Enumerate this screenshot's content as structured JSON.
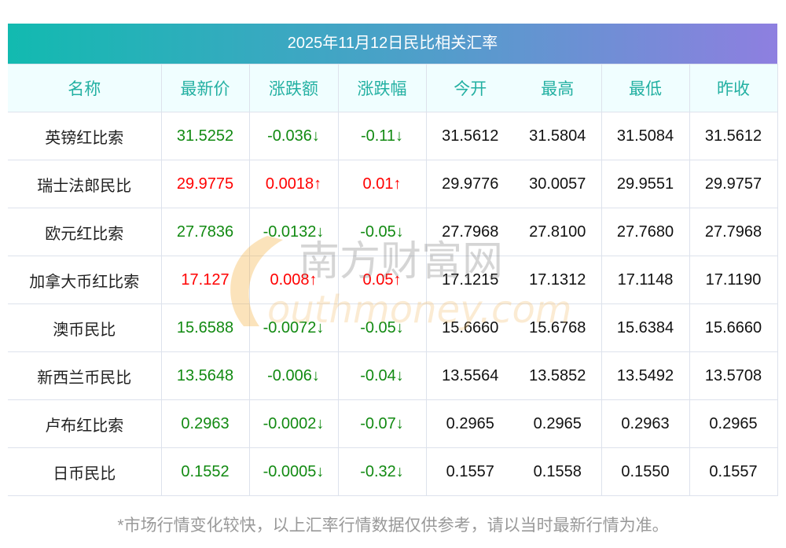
{
  "title": "2025年11月12日民比相关汇率",
  "headers": [
    "名称",
    "最新价",
    "涨跌额",
    "涨跌幅",
    "今开",
    "最高",
    "最低",
    "昨收"
  ],
  "rows": [
    {
      "name": "英镑红比索",
      "price": "31.5252",
      "change": "-0.036↓",
      "pct": "-0.11↓",
      "open": "31.5612",
      "high": "31.5804",
      "low": "31.5084",
      "prev": "31.5612",
      "dir": "down"
    },
    {
      "name": "瑞士法郎民比",
      "price": "29.9775",
      "change": "0.0018↑",
      "pct": "0.01↑",
      "open": "29.9776",
      "high": "30.0057",
      "low": "29.9551",
      "prev": "29.9757",
      "dir": "up"
    },
    {
      "name": "欧元红比索",
      "price": "27.7836",
      "change": "-0.0132↓",
      "pct": "-0.05↓",
      "open": "27.7968",
      "high": "27.8100",
      "low": "27.7680",
      "prev": "27.7968",
      "dir": "down"
    },
    {
      "name": "加拿大币红比索",
      "price": "17.127",
      "change": "0.008↑",
      "pct": "0.05↑",
      "open": "17.1215",
      "high": "17.1312",
      "low": "17.1148",
      "prev": "17.1190",
      "dir": "up"
    },
    {
      "name": "澳币民比",
      "price": "15.6588",
      "change": "-0.0072↓",
      "pct": "-0.05↓",
      "open": "15.6660",
      "high": "15.6768",
      "low": "15.6384",
      "prev": "15.6660",
      "dir": "down"
    },
    {
      "name": "新西兰币民比",
      "price": "13.5648",
      "change": "-0.006↓",
      "pct": "-0.04↓",
      "open": "13.5564",
      "high": "13.5852",
      "low": "13.5492",
      "prev": "13.5708",
      "dir": "down"
    },
    {
      "name": "卢布红比索",
      "price": "0.2963",
      "change": "-0.0002↓",
      "pct": "-0.07↓",
      "open": "0.2965",
      "high": "0.2965",
      "low": "0.2963",
      "prev": "0.2965",
      "dir": "down"
    },
    {
      "name": "日币民比",
      "price": "0.1552",
      "change": "-0.0005↓",
      "pct": "-0.32↓",
      "open": "0.1557",
      "high": "0.1558",
      "low": "0.1550",
      "prev": "0.1557",
      "dir": "down"
    }
  ],
  "watermark": {
    "cn": "南方财富网",
    "en": "southmoney.com"
  },
  "footer": "*市场行情变化较快，以上汇率行情数据仅供参考，请以当时最新行情为准。"
}
